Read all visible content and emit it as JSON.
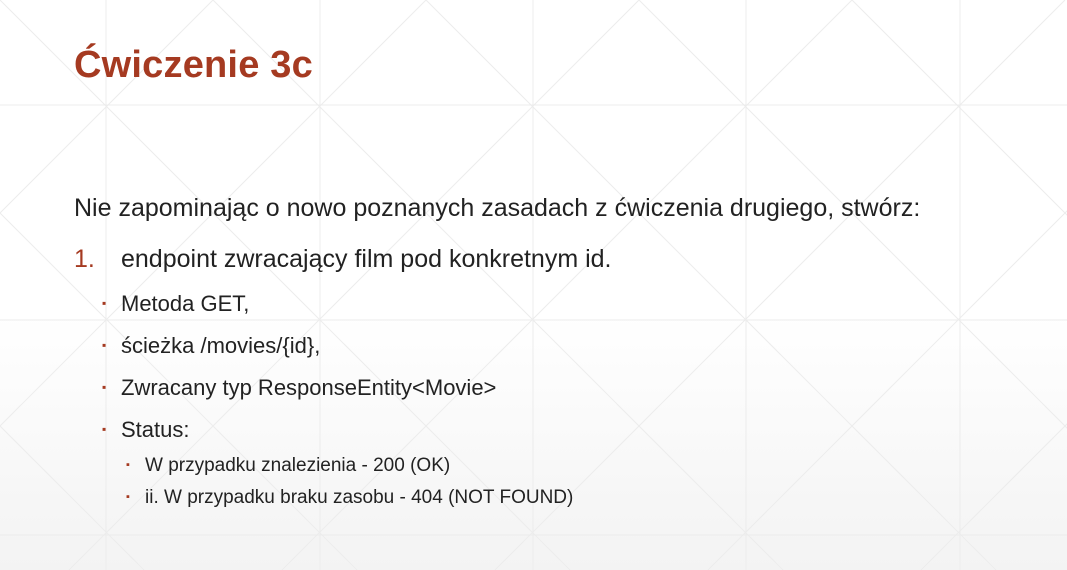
{
  "slide": {
    "title": "Ćwiczenie 3c",
    "intro": "Nie zapominając o nowo poznanych zasadach z ćwiczenia drugiego, stwórz:",
    "numbered_item": {
      "number": "1.",
      "text": "endpoint zwracający film pod konkretnym id."
    },
    "sub_items": [
      "Metoda GET,",
      "ścieżka /movies/{id},",
      "Zwracany typ ResponseEntity<Movie>",
      "Status:"
    ],
    "status_items": [
      "W przypadku znalezienia - 200 (OK)",
      "ii. W przypadku braku zasobu - 404 (NOT FOUND)"
    ],
    "bullet_glyph": "▪",
    "colors": {
      "accent": "#a53a21",
      "text": "#222222",
      "pattern": "#ececec"
    }
  }
}
